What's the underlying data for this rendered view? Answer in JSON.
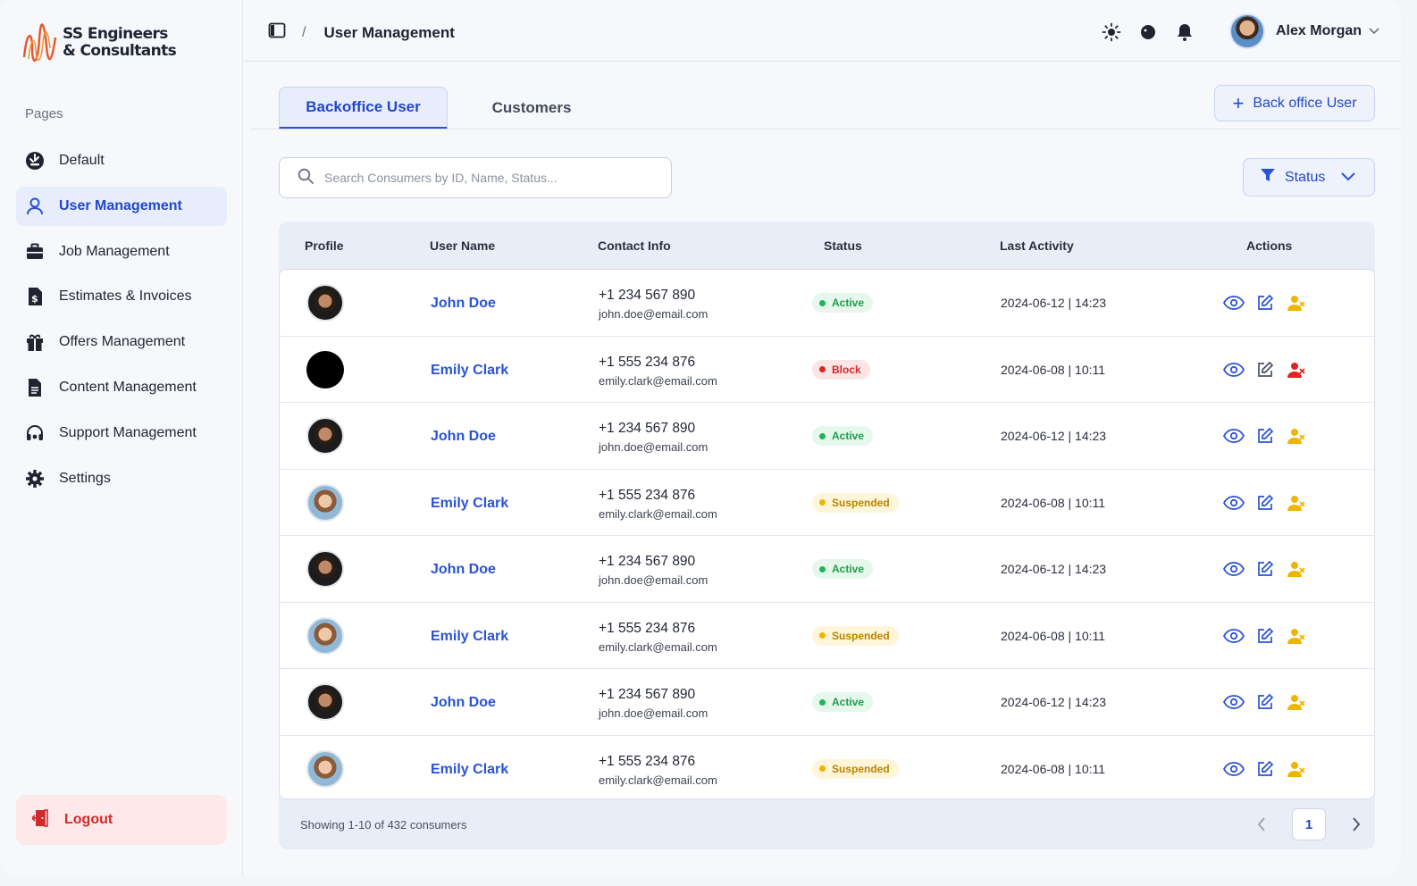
{
  "brand": {
    "line1": "SS Engineers",
    "line2": "& Consultants"
  },
  "sidebar": {
    "section_label": "Pages",
    "items": [
      {
        "label": "Default",
        "icon": "dashboard-icon",
        "active": false
      },
      {
        "label": "User Management",
        "icon": "user-icon",
        "active": true
      },
      {
        "label": "Job Management",
        "icon": "briefcase-icon",
        "active": false
      },
      {
        "label": "Estimates & Invoices",
        "icon": "invoice-icon",
        "active": false
      },
      {
        "label": "Offers Management",
        "icon": "gift-icon",
        "active": false
      },
      {
        "label": "Content Management",
        "icon": "document-icon",
        "active": false
      },
      {
        "label": "Support Management",
        "icon": "headset-icon",
        "active": false
      },
      {
        "label": "Settings",
        "icon": "gear-icon",
        "active": false
      }
    ],
    "logout_label": "Logout"
  },
  "header": {
    "separator": "/",
    "title": "User Management",
    "user_name": "Alex Morgan"
  },
  "tabs": [
    {
      "label": "Backoffice User",
      "active": true
    },
    {
      "label": "Customers",
      "active": false
    }
  ],
  "add_button_label": "Back office User",
  "search": {
    "placeholder": "Search Consumers by ID, Name, Status...",
    "value": ""
  },
  "filter": {
    "label": "Status"
  },
  "table": {
    "columns": [
      "Profile",
      "User Name",
      "Contact Info",
      "Status",
      "Last Activity",
      "Actions"
    ],
    "rows": [
      {
        "avatar": "john",
        "name": "John Doe",
        "phone": "+1 234 567 890",
        "email": "john.doe@email.com",
        "status": "Active",
        "last_activity": "2024-06-12 | 14:23"
      },
      {
        "avatar": "blank",
        "name": "Emily Clark",
        "phone": "+1 555 234 876",
        "email": "emily.clark@email.com",
        "status": "Block",
        "last_activity": "2024-06-08 | 10:11"
      },
      {
        "avatar": "john",
        "name": "John Doe",
        "phone": "+1 234 567 890",
        "email": "john.doe@email.com",
        "status": "Active",
        "last_activity": "2024-06-12 | 14:23"
      },
      {
        "avatar": "emily",
        "name": "Emily Clark",
        "phone": "+1 555 234 876",
        "email": "emily.clark@email.com",
        "status": "Suspended",
        "last_activity": "2024-06-08 | 10:11"
      },
      {
        "avatar": "john",
        "name": "John Doe",
        "phone": "+1 234 567 890",
        "email": "john.doe@email.com",
        "status": "Active",
        "last_activity": "2024-06-12 | 14:23"
      },
      {
        "avatar": "emily",
        "name": "Emily Clark",
        "phone": "+1 555 234 876",
        "email": "emily.clark@email.com",
        "status": "Suspended",
        "last_activity": "2024-06-08 | 10:11"
      },
      {
        "avatar": "john",
        "name": "John Doe",
        "phone": "+1 234 567 890",
        "email": "john.doe@email.com",
        "status": "Active",
        "last_activity": "2024-06-12 | 14:23"
      },
      {
        "avatar": "emily",
        "name": "Emily Clark",
        "phone": "+1 555 234 876",
        "email": "emily.clark@email.com",
        "status": "Suspended",
        "last_activity": "2024-06-08 | 10:11"
      }
    ]
  },
  "footer": {
    "showing": "Showing 1-10 of 432 consumers",
    "current_page": "1"
  },
  "colors": {
    "accent": "#2a52d6",
    "active": "#22b35a",
    "block": "#e02424",
    "suspended": "#f0b400",
    "logout": "#d02a2a"
  }
}
